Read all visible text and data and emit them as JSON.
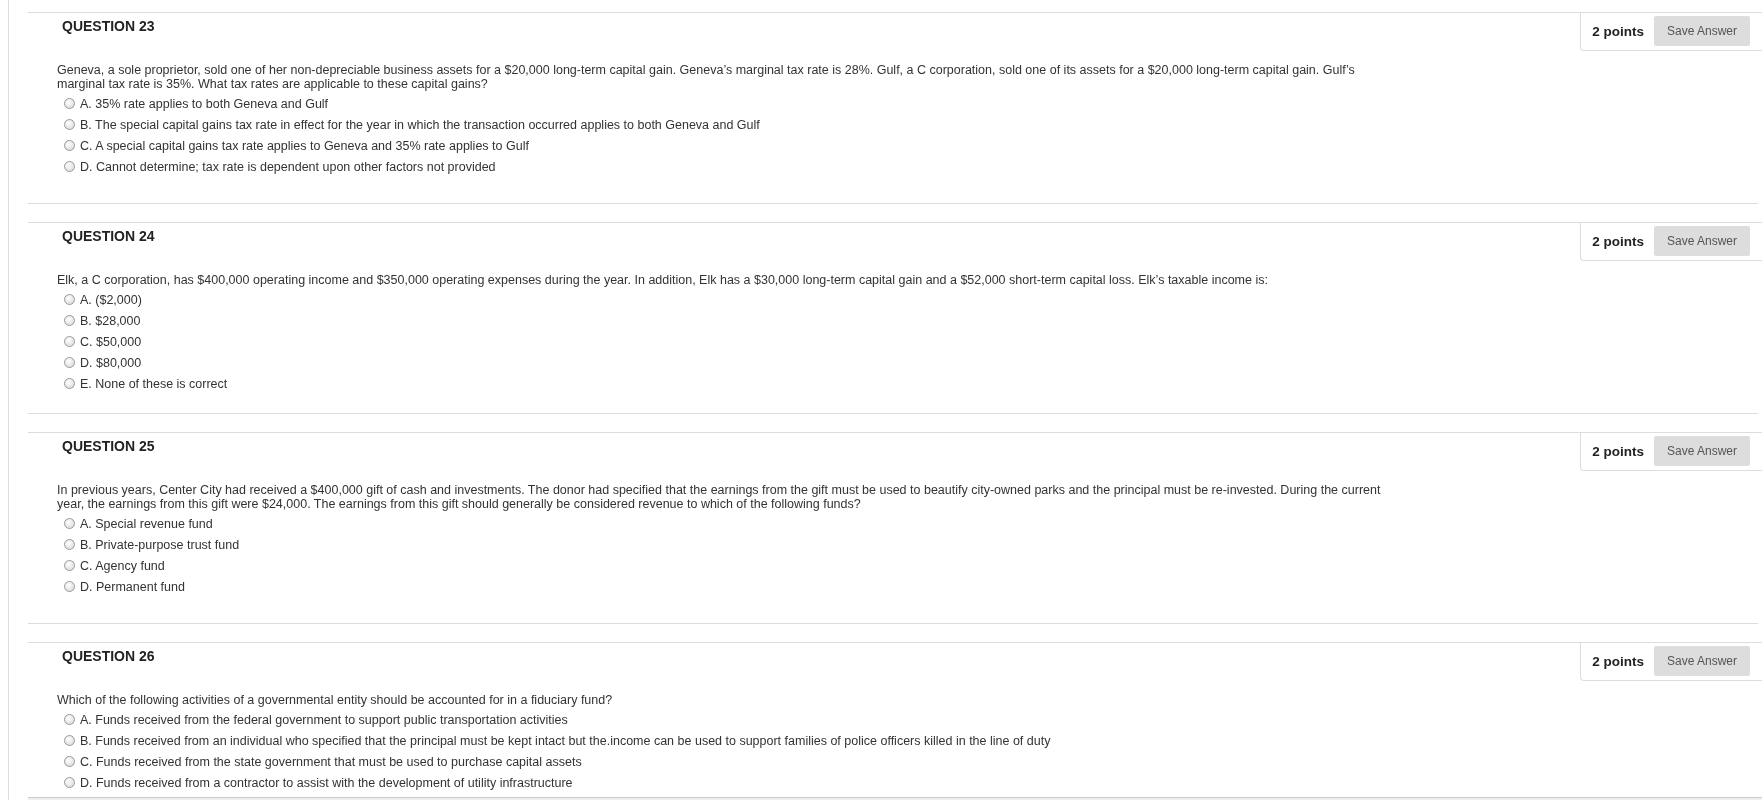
{
  "questions": [
    {
      "title": "QUESTION 23",
      "points": "2 points",
      "save_button": "Save Answer",
      "text": "Geneva, a sole proprietor, sold one of her non-depreciable business assets for a $20,000 long-term capital gain. Geneva’s marginal tax rate is 28%. Gulf, a C corporation, sold one of its assets for a $20,000 long-term capital gain. Gulf’s marginal tax rate is 35%. What tax rates are applicable to these capital gains?",
      "options": [
        {
          "label": "A. 35% rate applies to both Geneva and Gulf",
          "selected": false
        },
        {
          "label": "B. The special capital gains tax rate in effect for the year in which the transaction occurred applies to both Geneva and Gulf",
          "selected": false
        },
        {
          "label": "C. A special capital gains tax rate applies to Geneva and 35% rate applies to Gulf",
          "selected": false
        },
        {
          "label": "D. Cannot determine; tax rate is dependent upon other factors not provided",
          "selected": false
        }
      ]
    },
    {
      "title": "QUESTION 24",
      "points": "2 points",
      "save_button": "Save Answer",
      "text": "Elk, a C corporation, has $400,000 operating income and $350,000 operating expenses during the year. In addition, Elk has a $30,000 long-term capital gain and a $52,000 short-term capital loss. Elk’s taxable income is:",
      "options": [
        {
          "label": "A. ($2,000)",
          "selected": false
        },
        {
          "label": "B. $28,000",
          "selected": false
        },
        {
          "label": "C. $50,000",
          "selected": false
        },
        {
          "label": "D. $80,000",
          "selected": false
        },
        {
          "label": "E. None of these is correct",
          "selected": false
        }
      ]
    },
    {
      "title": "QUESTION 25",
      "points": "2 points",
      "save_button": "Save Answer",
      "text": "In previous years, Center City had received a $400,000 gift of cash and investments. The donor had specified that the earnings from the gift must be used to beautify city-owned parks and the principal must be re-invested. During the current year, the earnings from this gift were $24,000. The earnings from this gift should generally be considered revenue to which of the following funds?",
      "options": [
        {
          "label": "A. Special revenue fund",
          "selected": false
        },
        {
          "label": "B. Private-purpose trust fund",
          "selected": false
        },
        {
          "label": "C. Agency fund",
          "selected": false
        },
        {
          "label": "D. Permanent fund",
          "selected": false
        }
      ]
    },
    {
      "title": "QUESTION 26",
      "points": "2 points",
      "save_button": "Save Answer",
      "text": "Which of the following activities of a governmental entity should be accounted for in a fiduciary fund?",
      "options": [
        {
          "label": "A. Funds received from the federal government to support public transportation activities",
          "selected": false
        },
        {
          "label": "B. Funds received from an individual who specified that the principal must be kept intact but the.income can be used to support families of police officers killed in the line of duty",
          "selected": false
        },
        {
          "label": "C. Funds received from the state government that must be used to purchase capital assets",
          "selected": false
        },
        {
          "label": "D. Funds received from a contractor to assist with the development of utility infrastructure",
          "selected": false
        }
      ]
    }
  ]
}
